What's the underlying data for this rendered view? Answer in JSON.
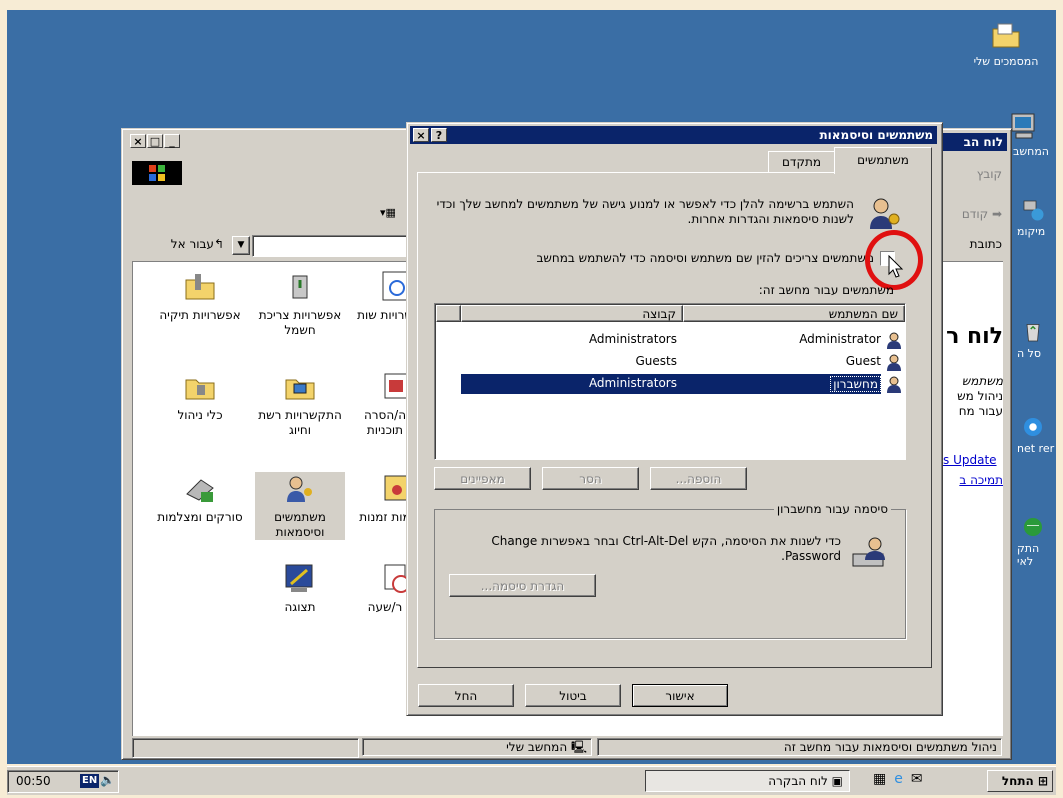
{
  "desktop": {
    "icons": [
      {
        "label": "המסמכים שלי",
        "icon": "folder-documents-icon"
      },
      {
        "label": "המחשב",
        "icon": "my-computer-icon"
      },
      {
        "label": "מיקומ",
        "icon": "network-places-icon"
      },
      {
        "label": "סל ה",
        "icon": "recycle-bin-icon"
      },
      {
        "label": "net rer",
        "icon": "internet-explorer-icon"
      },
      {
        "label": "התק לאי",
        "icon": "connect-internet-icon"
      }
    ]
  },
  "control_panel": {
    "menu_left": "קובץ",
    "back_label": "קודם",
    "address_label": "כתובת",
    "go_label": "עבור אל",
    "title_fragment": "לוח הב",
    "heading_fragment": "לוח ר",
    "side_text": [
      "משתמש",
      "ניהול מש",
      "עבור מח"
    ],
    "side_links": [
      "s Update",
      "תמיכה ב"
    ],
    "items": [
      {
        "label": "אפשרויות תיקיה",
        "icon": "folder-options-icon"
      },
      {
        "label": "אפשרויות צריכת חשמל",
        "icon": "power-options-icon"
      },
      {
        "label": "שרויות שות",
        "icon": "accessibility-icon"
      },
      {
        "label": "כלי ניהול",
        "icon": "admin-tools-icon"
      },
      {
        "label": "התקשרויות רשת וחיוג",
        "icon": "network-dialup-icon"
      },
      {
        "label": "ה/הסרה תוכניות",
        "icon": "add-remove-programs-icon"
      },
      {
        "label": "סורקים ומצלמות",
        "icon": "scanner-camera-icon"
      },
      {
        "label": "משתמשים וסיסמאות",
        "icon": "users-passwords-icon"
      },
      {
        "label": "מות זמנות",
        "icon": "scheduled-tasks-icon"
      },
      {
        "label": "תצוגה",
        "icon": "display-icon"
      },
      {
        "label": "ר/שעה",
        "icon": "date-time-icon"
      }
    ],
    "status_left": "ניהול משתמשים וסיסמאות עבור מחשב זה",
    "status_right": "המחשב שלי"
  },
  "dialog": {
    "title": "משתמשים וסיסמאות",
    "help_btn": "?",
    "close_btn": "×",
    "tabs": [
      "משתמשים",
      "מתקדם"
    ],
    "intro_text": "השתמש ברשימה להלן כדי לאפשר או למנוע גישה של משתמשים למחשב שלך וכדי לשנות סיסמאות והגדרות אחרות.",
    "checkbox_label": "משתמשים צריכים להזין שם משתמש וסיסמה כדי להשתמש במחשב",
    "list_caption": "משתמשים עבור מחשב זה:",
    "columns": [
      "שם המשתמש",
      "קבוצה"
    ],
    "rows": [
      {
        "user": "Administrator",
        "group": "Administrators",
        "selected": false
      },
      {
        "user": "Guest",
        "group": "Guests",
        "selected": false
      },
      {
        "user": "מחשברון",
        "group": "Administrators",
        "selected": true
      }
    ],
    "btn_add": "הוספה...",
    "btn_remove": "הסר",
    "btn_properties": "מאפיינים",
    "password_group_title": "סיסמה עבור מחשברון",
    "password_text": "כדי לשנות את הסיסמה, הקש Ctrl-Alt-Del ובחר באפשרות Change Password.",
    "btn_set_password": "הגדרת סיסמה...",
    "btn_ok": "אישור",
    "btn_cancel": "ביטול",
    "btn_apply": "החל"
  },
  "taskbar": {
    "start_label": "התחל",
    "task_label": "לוח הבקרה",
    "clock": "00:50",
    "lang": "EN"
  },
  "colors": {
    "desktop": "#3a6ea5",
    "title_active": "#0a246a",
    "selection": "#0a246a",
    "highlight_circle": "#e01010"
  }
}
